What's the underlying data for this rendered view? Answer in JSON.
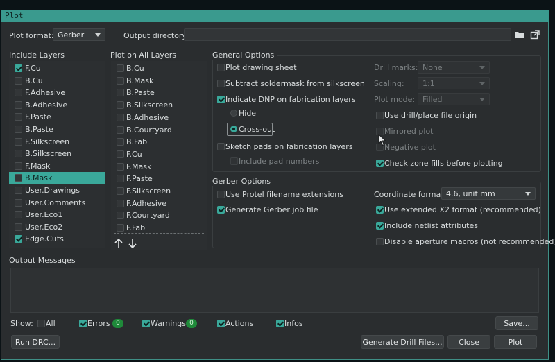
{
  "window": {
    "title": "Plot"
  },
  "top": {
    "plot_format_label": "Plot format:",
    "plot_format_value": "Gerber",
    "output_dir_label": "Output directory:",
    "output_dir_value": ""
  },
  "include_layers": {
    "title": "Include Layers",
    "items": [
      {
        "label": "F.Cu",
        "checked": true
      },
      {
        "label": "B.Cu",
        "checked": false
      },
      {
        "label": "F.Adhesive",
        "checked": false
      },
      {
        "label": "B.Adhesive",
        "checked": false
      },
      {
        "label": "F.Paste",
        "checked": false
      },
      {
        "label": "B.Paste",
        "checked": false
      },
      {
        "label": "F.Silkscreen",
        "checked": false
      },
      {
        "label": "B.Silkscreen",
        "checked": false
      },
      {
        "label": "F.Mask",
        "checked": false
      },
      {
        "label": "B.Mask",
        "checked": false,
        "selected": true
      },
      {
        "label": "User.Drawings",
        "checked": false
      },
      {
        "label": "User.Comments",
        "checked": false
      },
      {
        "label": "User.Eco1",
        "checked": false
      },
      {
        "label": "User.Eco2",
        "checked": false
      },
      {
        "label": "Edge.Cuts",
        "checked": true
      }
    ]
  },
  "plot_all_layers": {
    "title": "Plot on All Layers",
    "items": [
      {
        "label": "B.Cu"
      },
      {
        "label": "B.Mask"
      },
      {
        "label": "B.Paste"
      },
      {
        "label": "B.Silkscreen"
      },
      {
        "label": "B.Adhesive"
      },
      {
        "label": "B.Courtyard"
      },
      {
        "label": "B.Fab"
      },
      {
        "label": "F.Cu"
      },
      {
        "label": "F.Mask"
      },
      {
        "label": "F.Paste"
      },
      {
        "label": "F.Silkscreen"
      },
      {
        "label": "F.Adhesive"
      },
      {
        "label": "F.Courtyard"
      },
      {
        "label": "F.Fab"
      }
    ]
  },
  "general": {
    "title": "General Options",
    "plot_drawing_sheet": "Plot drawing sheet",
    "subtract_soldermask": "Subtract soldermask from silkscreen",
    "indicate_dnp": "Indicate DNP on fabrication layers",
    "hide": "Hide",
    "cross_out": "Cross-out",
    "sketch_pads": "Sketch pads on fabrication layers",
    "include_pad_numbers": "Include pad numbers",
    "drill_marks_label": "Drill marks:",
    "drill_marks_value": "None",
    "scaling_label": "Scaling:",
    "scaling_value": "1:1",
    "plot_mode_label": "Plot mode:",
    "plot_mode_value": "Filled",
    "use_drill_origin": "Use drill/place file origin",
    "mirrored_plot": "Mirrored plot",
    "negative_plot": "Negative plot",
    "check_zone_fills": "Check zone fills before plotting"
  },
  "gerber": {
    "title": "Gerber Options",
    "protel_names": "Use Protel filename extensions",
    "job_file": "Generate Gerber job file",
    "coord_format_label": "Coordinate format:",
    "coord_format_value": "4.6, unit mm",
    "x2_format": "Use extended X2 format (recommended)",
    "netlist_attrs": "Include netlist attributes",
    "disable_aperture": "Disable aperture macros (not recommended)"
  },
  "messages": {
    "title": "Output Messages",
    "show_label": "Show:",
    "all": "All",
    "errors": "Errors",
    "errors_count": "0",
    "warnings": "Warnings",
    "warnings_count": "0",
    "actions": "Actions",
    "infos": "Infos",
    "save": "Save..."
  },
  "buttons": {
    "run_drc": "Run DRC...",
    "gen_drill": "Generate Drill Files...",
    "close": "Close",
    "plot": "Plot"
  },
  "colors": {
    "accent": "#3aa89a",
    "badge": "#1f8a3a"
  }
}
